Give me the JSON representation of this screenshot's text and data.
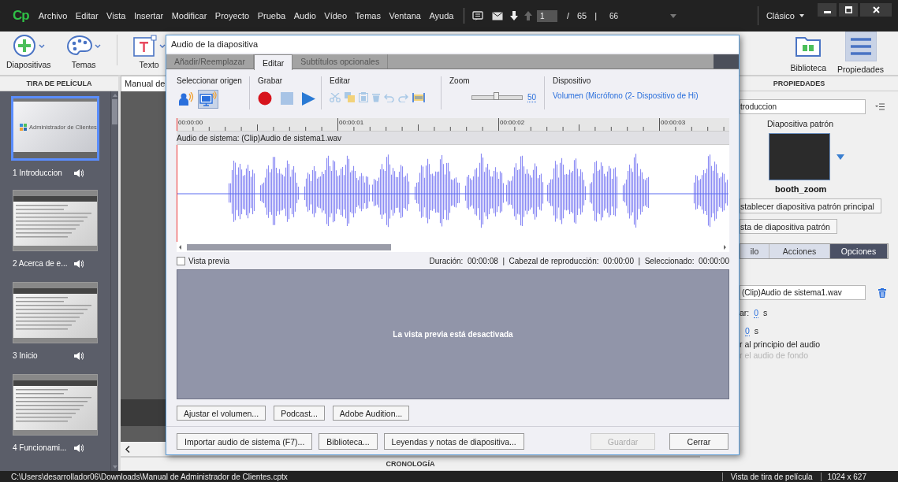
{
  "menu_bar": {
    "logo": "Cp",
    "menus": [
      "Archivo",
      "Editar",
      "Vista",
      "Insertar",
      "Modificar",
      "Proyecto",
      "Prueba",
      "Audio",
      "Vídeo",
      "Temas",
      "Ventana",
      "Ayuda"
    ],
    "current_slide": "1",
    "slash": "/",
    "slide_count": "65",
    "separator": "|",
    "zoom_value": "66",
    "workspace": "Clásico"
  },
  "toolbar": {
    "left": [
      {
        "label": "Diapositivas",
        "kind": "slides"
      },
      {
        "label": "Temas",
        "kind": "themes"
      },
      {
        "label": "Texto",
        "kind": "text"
      }
    ],
    "right": [
      {
        "label": "Biblioteca",
        "kind": "library",
        "selected": false
      },
      {
        "label": "Propiedades",
        "kind": "properties",
        "selected": true
      }
    ]
  },
  "filmstrip": {
    "title": "TIRA DE PELÍCULA",
    "slides": [
      {
        "label": "1 Introduccion",
        "kind": "title",
        "heading": "Administrador de Clientes",
        "selected": true
      },
      {
        "label": "2 Acerca de e...",
        "kind": "content",
        "selected": false
      },
      {
        "label": "3 Inicio",
        "kind": "content",
        "selected": false
      },
      {
        "label": "4 Funcionami...",
        "kind": "content",
        "selected": false
      }
    ]
  },
  "stage": {
    "document_tab": "Manual de",
    "timeline_title": "CRONOLOGÍA"
  },
  "properties": {
    "title": "PROPIEDADES",
    "slide_name": "troduccion",
    "master_label": "Diapositiva patrón",
    "master_name": "booth_zoom",
    "buttons": [
      "stablecer diapositiva patrón principal",
      "sta de diapositiva patrón"
    ],
    "tabs": [
      {
        "label": "ilo",
        "selected": false
      },
      {
        "label": "Acciones",
        "selected": false
      },
      {
        "label": "Opciones",
        "selected": true
      }
    ],
    "audio_file": "(Clip)Audio de sistema1.wav",
    "rows": [
      {
        "kind": "number",
        "label": "ar:",
        "value": "0",
        "unit": "s"
      },
      {
        "kind": "number",
        "value": "0",
        "unit": "s"
      },
      {
        "kind": "option",
        "label": "r al principio del audio",
        "disabled": false
      },
      {
        "kind": "option",
        "label": "r el audio de fondo",
        "disabled": true
      }
    ]
  },
  "dialog": {
    "title": "Audio de la diapositiva",
    "tabs": [
      {
        "label": "Añadir/Reemplazar",
        "selected": false
      },
      {
        "label": "Editar",
        "selected": true
      },
      {
        "label": "Subtítulos opcionales",
        "selected": false
      }
    ],
    "tools": {
      "source": {
        "label": "Seleccionar origen",
        "options": [
          {
            "kind": "microphone",
            "selected": false
          },
          {
            "kind": "system",
            "selected": true
          }
        ]
      },
      "record": {
        "label": "Grabar"
      },
      "edit": {
        "label": "Editar"
      },
      "zoom": {
        "label": "Zoom",
        "level": 0.5,
        "value": "50"
      },
      "device": {
        "label": "Dispositivo",
        "value": "Volumen (Micrófono (2- Dispositivo de Hi)"
      }
    },
    "ruler": [
      "00:00:00",
      "00:00:01",
      "00:00:02",
      "00:00:03"
    ],
    "track_label": "Audio de sistema: (Clip)Audio de sistema1.wav",
    "preview": {
      "label": "Vista previa",
      "checked": false
    },
    "info": "Duración:  00:00:08  |  Cabezal de reproducción:  00:00:00  |  Seleccionado:  00:00:00",
    "preview_message": "La vista previa está desactivada",
    "tool_buttons": [
      "Ajustar el volumen...",
      "Podcast...",
      "Adobe Audition..."
    ],
    "footer_left": [
      {
        "label": "Importar audio de sistema (F7)...",
        "disabled": false
      },
      {
        "label": "Biblioteca...",
        "disabled": false
      },
      {
        "label": "Leyendas y notas de diapositiva...",
        "disabled": false
      }
    ],
    "footer_right": [
      {
        "label": "Guardar",
        "disabled": true
      },
      {
        "label": "Cerrar",
        "disabled": false
      }
    ]
  },
  "status_bar": {
    "path": "C:\\Users\\desarrollador06\\Downloads\\Manual de Administrador de Clientes.cptx",
    "view": "Vista de tira de película",
    "size": "1024 x 627"
  }
}
